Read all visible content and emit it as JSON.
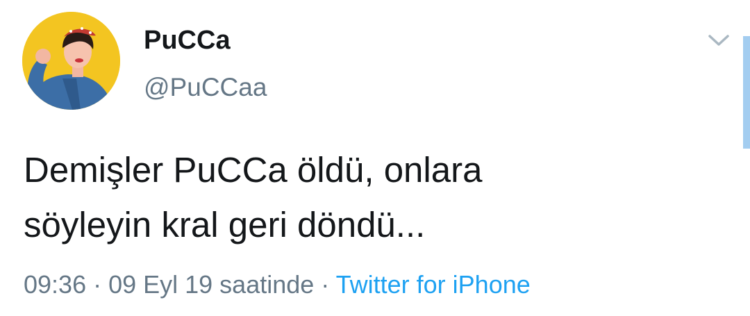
{
  "user": {
    "display_name": "PuCCa",
    "handle": "@PuCCaa",
    "avatar_icon": "profile-photo"
  },
  "tweet": {
    "text_line_1": "Demişler PuCCa öldü, onlara",
    "text_line_2": "söyleyin kral geri döndü..."
  },
  "meta": {
    "timestamp": "09:36 · 09 Eyl 19 saatinde",
    "separator": " · ",
    "source": "Twitter for iPhone"
  },
  "icons": {
    "more": "chevron-down-icon"
  },
  "colors": {
    "text_primary": "#14171a",
    "text_secondary": "#657786",
    "link": "#1da1f2",
    "avatar_bg": "#f3c521"
  }
}
